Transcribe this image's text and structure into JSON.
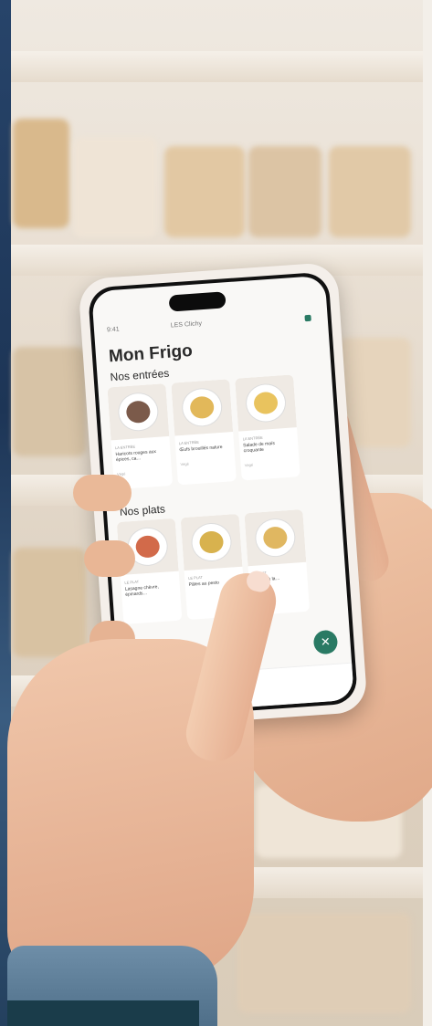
{
  "screen": {
    "status_left": "9:41",
    "location": "LES Clichy",
    "title": "Mon Frigo",
    "sections": [
      {
        "label": "Nos entrées",
        "items": [
          {
            "category": "LA ENTRÉE",
            "name": "Haricots rouges aux épices, ca…",
            "meta": "Végé",
            "color": "#7b5a4a"
          },
          {
            "category": "LA ENTRÉE",
            "name": "Œufs brouillés nature",
            "meta": "Végé",
            "color": "#e2b85a"
          },
          {
            "category": "LA ENTRÉE",
            "name": "Salade de maïs croquante",
            "meta": "Végé",
            "color": "#e9c35e"
          }
        ]
      },
      {
        "label": "Nos plats",
        "items": [
          {
            "category": "LE PLAT",
            "name": "Lasagne chèvre, épinards…",
            "meta": "",
            "color": "#d26a4a"
          },
          {
            "category": "LE PLAT",
            "name": "Pâtes au pesto",
            "meta": "",
            "color": "#d8b24e"
          },
          {
            "category": "LE PLAT",
            "name": "Risotto à la…",
            "meta": "",
            "color": "#e0b761"
          }
        ]
      }
    ],
    "fab_icon": "grid-icon",
    "accent": "#2a7a64"
  }
}
